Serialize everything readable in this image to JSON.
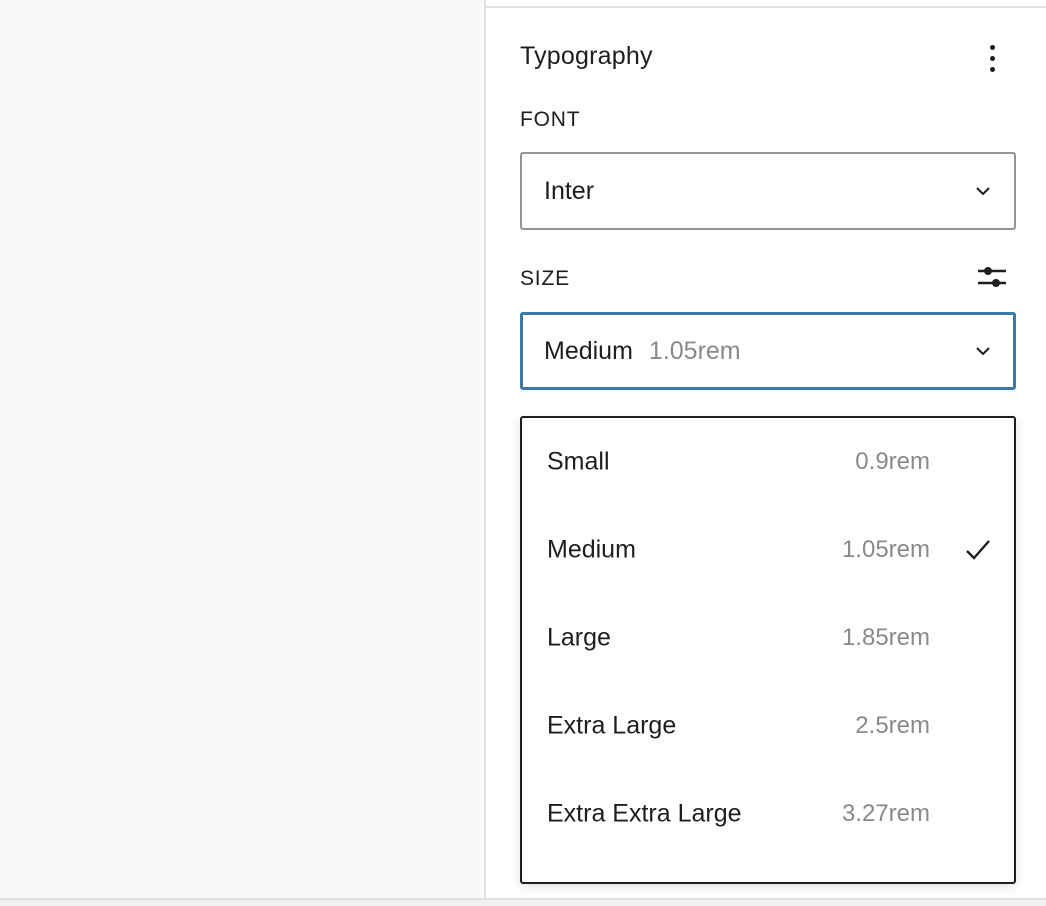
{
  "panel": {
    "title": "Typography"
  },
  "font": {
    "label": "FONT",
    "value": "Inter"
  },
  "size": {
    "label": "SIZE",
    "value": "Medium",
    "hint": "1.05rem"
  },
  "size_options": [
    {
      "label": "Small",
      "hint": "0.9rem",
      "selected": false
    },
    {
      "label": "Medium",
      "hint": "1.05rem",
      "selected": true
    },
    {
      "label": "Large",
      "hint": "1.85rem",
      "selected": false
    },
    {
      "label": "Extra Large",
      "hint": "2.5rem",
      "selected": false
    },
    {
      "label": "Extra Extra Large",
      "hint": "3.27rem",
      "selected": false
    }
  ],
  "icons": {
    "more": "more-vertical-icon",
    "chevron": "chevron-down-icon",
    "filters": "sliders-icon",
    "check": "check-icon"
  },
  "colors": {
    "focus": "#3a78a8",
    "text": "#1e1e1e",
    "muted": "#8a8a8a"
  }
}
